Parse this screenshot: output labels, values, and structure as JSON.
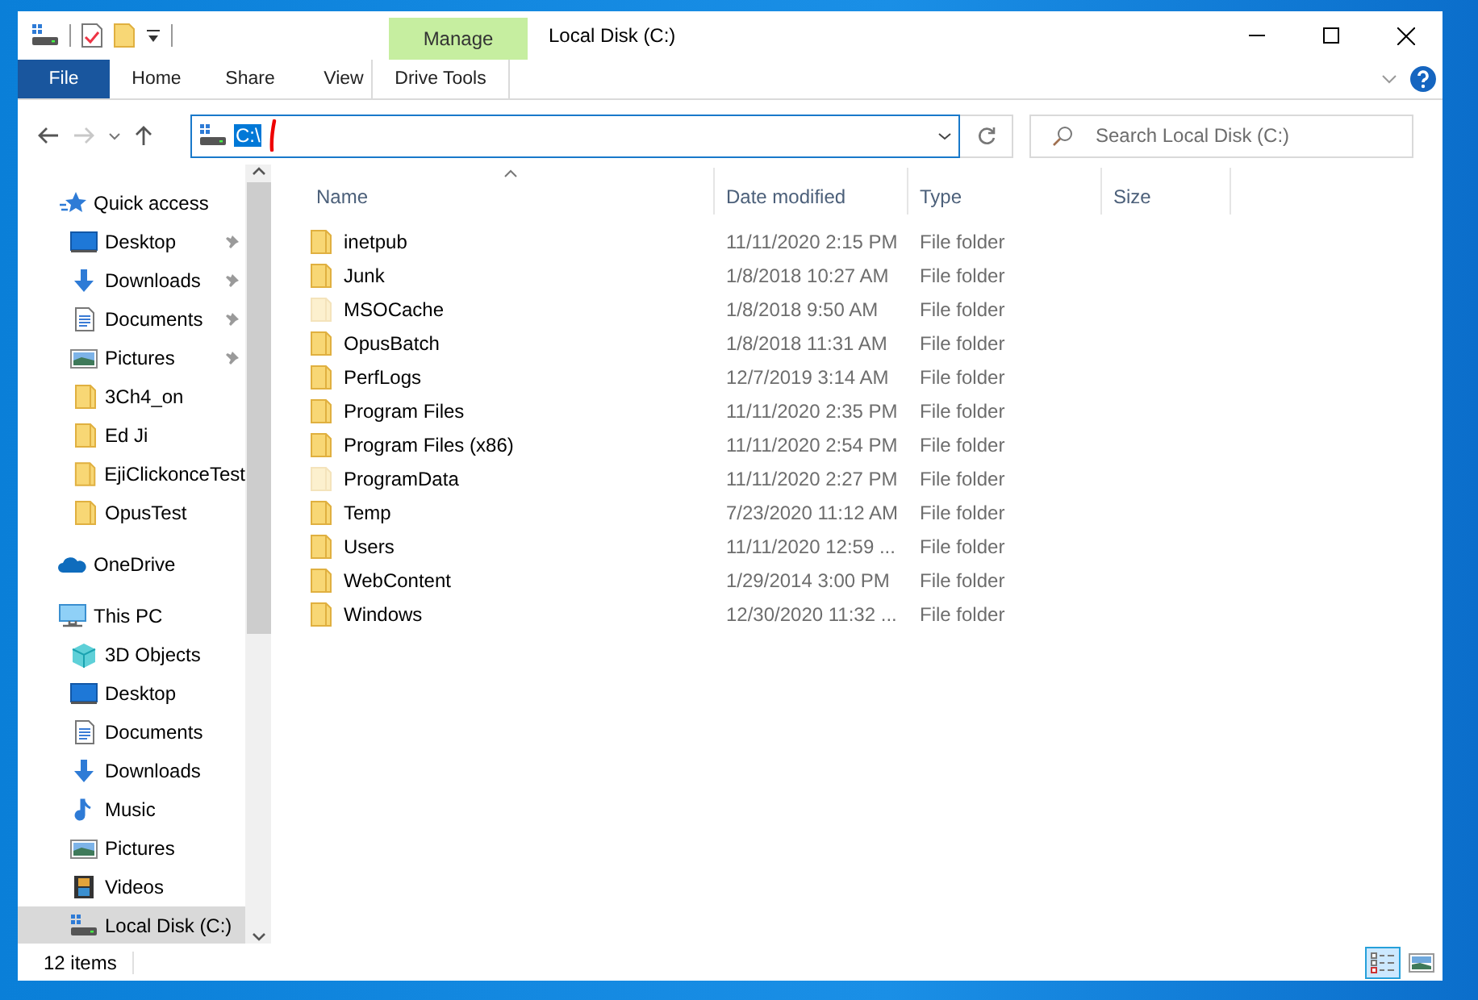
{
  "window": {
    "title": "Local Disk (C:)"
  },
  "ribbon": {
    "context_label": "Manage",
    "tabs": [
      {
        "label": "File",
        "kind": "file"
      },
      {
        "label": "Home",
        "kind": "tab"
      },
      {
        "label": "Share",
        "kind": "tab"
      },
      {
        "label": "View",
        "kind": "tab"
      },
      {
        "label": "Drive Tools",
        "kind": "context"
      }
    ]
  },
  "address": {
    "value": "C:\\",
    "selected": true
  },
  "search": {
    "placeholder": "Search Local Disk (C:)"
  },
  "sidebar": {
    "items": [
      {
        "label": "Quick access",
        "kind": "star",
        "selected": false,
        "children": [
          {
            "label": "Desktop",
            "kind": "desktop",
            "pinned": true,
            "selected": false
          },
          {
            "label": "Downloads",
            "kind": "downloads",
            "pinned": true,
            "selected": false
          },
          {
            "label": "Documents",
            "kind": "documents",
            "pinned": true,
            "selected": false
          },
          {
            "label": "Pictures",
            "kind": "pictures",
            "pinned": true,
            "selected": false
          },
          {
            "label": "3Ch4_on",
            "kind": "folder",
            "pinned": false,
            "selected": false
          },
          {
            "label": "Ed Ji",
            "kind": "folder",
            "pinned": false,
            "selected": false
          },
          {
            "label": "EjiClickonceTest",
            "kind": "folder",
            "pinned": false,
            "selected": false
          },
          {
            "label": "OpusTest",
            "kind": "folder",
            "pinned": false,
            "selected": false
          }
        ]
      },
      {
        "label": "OneDrive",
        "kind": "cloud",
        "selected": false
      },
      {
        "label": "This PC",
        "kind": "pc",
        "selected": false,
        "children": [
          {
            "label": "3D Objects",
            "kind": "cube",
            "pinned": false,
            "selected": false
          },
          {
            "label": "Desktop",
            "kind": "desktop",
            "pinned": false,
            "selected": false
          },
          {
            "label": "Documents",
            "kind": "documents",
            "pinned": false,
            "selected": false
          },
          {
            "label": "Downloads",
            "kind": "downloads",
            "pinned": false,
            "selected": false
          },
          {
            "label": "Music",
            "kind": "music",
            "pinned": false,
            "selected": false
          },
          {
            "label": "Pictures",
            "kind": "pictures",
            "pinned": false,
            "selected": false
          },
          {
            "label": "Videos",
            "kind": "videos",
            "pinned": false,
            "selected": false
          },
          {
            "label": "Local Disk (C:)",
            "kind": "drive",
            "pinned": false,
            "selected": true
          }
        ]
      }
    ]
  },
  "table": {
    "columns": [
      {
        "label": "Name",
        "sorted": true
      },
      {
        "label": "Date modified",
        "sorted": false
      },
      {
        "label": "Type",
        "sorted": false
      },
      {
        "label": "Size",
        "sorted": false
      }
    ],
    "rows": [
      {
        "name": "inetpub",
        "date": "11/11/2020 2:15 PM",
        "type": "File folder",
        "hidden": false
      },
      {
        "name": "Junk",
        "date": "1/8/2018 10:27 AM",
        "type": "File folder",
        "hidden": false
      },
      {
        "name": "MSOCache",
        "date": "1/8/2018 9:50 AM",
        "type": "File folder",
        "hidden": true
      },
      {
        "name": "OpusBatch",
        "date": "1/8/2018 11:31 AM",
        "type": "File folder",
        "hidden": false
      },
      {
        "name": "PerfLogs",
        "date": "12/7/2019 3:14 AM",
        "type": "File folder",
        "hidden": false
      },
      {
        "name": "Program Files",
        "date": "11/11/2020 2:35 PM",
        "type": "File folder",
        "hidden": false
      },
      {
        "name": "Program Files (x86)",
        "date": "11/11/2020 2:54 PM",
        "type": "File folder",
        "hidden": false
      },
      {
        "name": "ProgramData",
        "date": "11/11/2020 2:27 PM",
        "type": "File folder",
        "hidden": true
      },
      {
        "name": "Temp",
        "date": "7/23/2020 11:12 AM",
        "type": "File folder",
        "hidden": false
      },
      {
        "name": "Users",
        "date": "11/11/2020 12:59 ...",
        "type": "File folder",
        "hidden": false
      },
      {
        "name": "WebContent",
        "date": "1/29/2014 3:00 PM",
        "type": "File folder",
        "hidden": false
      },
      {
        "name": "Windows",
        "date": "12/30/2020 11:32 ...",
        "type": "File folder",
        "hidden": false
      }
    ]
  },
  "status_bar": {
    "count": "12 items",
    "views": [
      {
        "kind": "details",
        "selected": true
      },
      {
        "kind": "thumbnails",
        "selected": false
      }
    ]
  }
}
